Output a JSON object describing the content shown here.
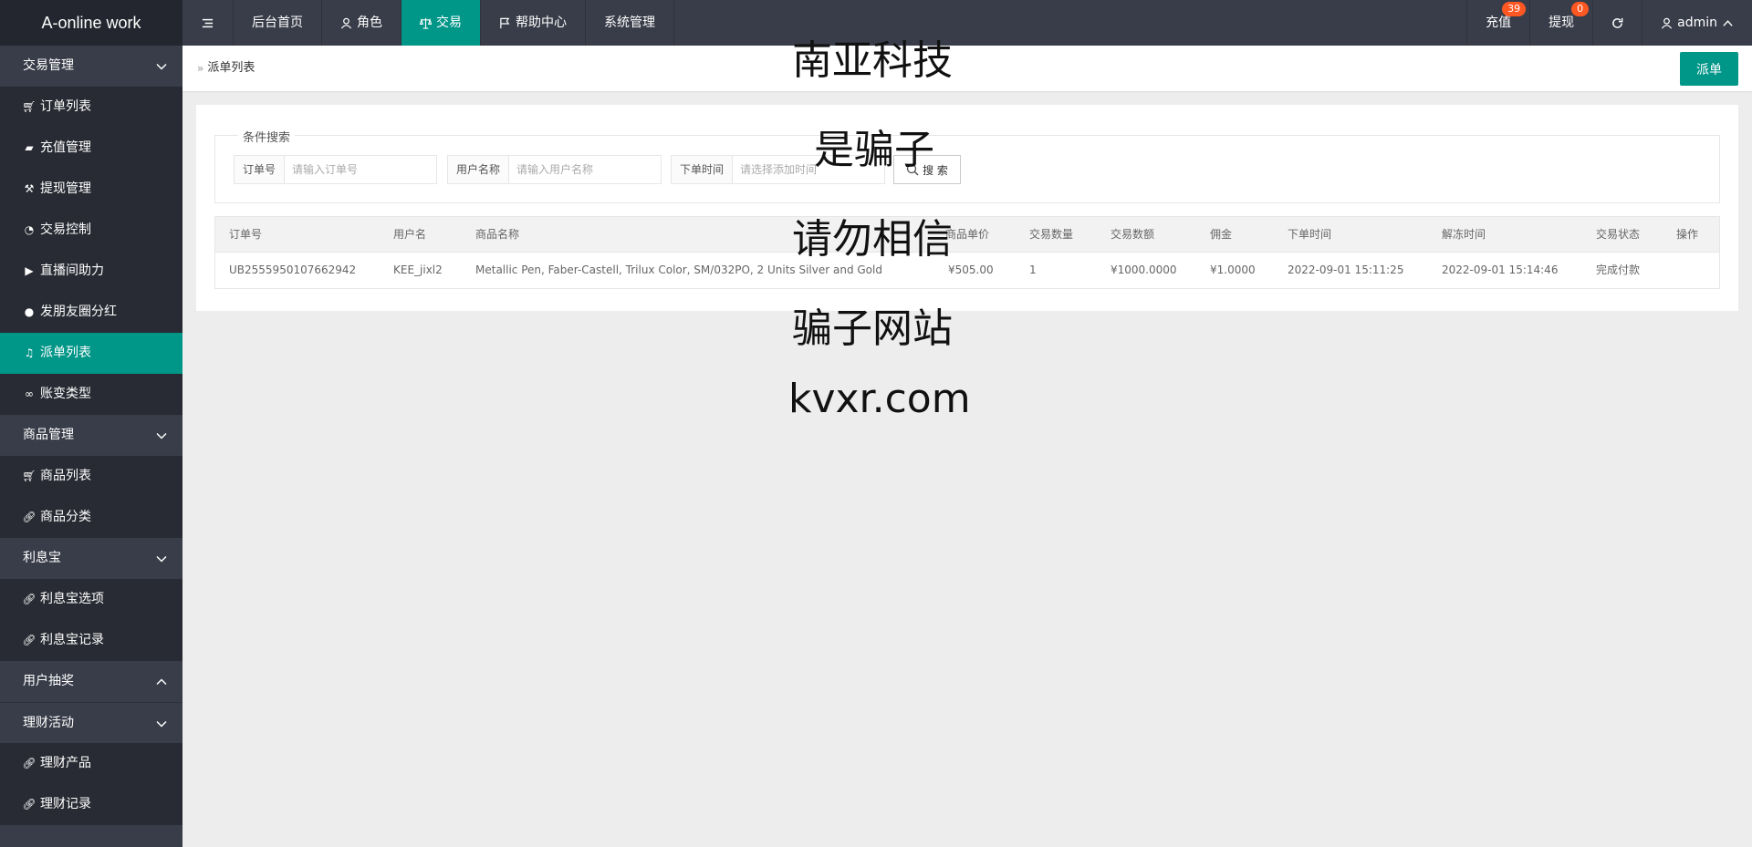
{
  "header": {
    "logo": "A-online work",
    "nav": [
      {
        "label": "后台首页"
      },
      {
        "label": "角色"
      },
      {
        "label": "交易"
      },
      {
        "label": "帮助中心"
      },
      {
        "label": "系统管理"
      }
    ],
    "right": {
      "recharge_label": "充值",
      "recharge_badge": "39",
      "withdraw_label": "提现",
      "withdraw_badge": "0",
      "user_label": "admin"
    }
  },
  "sidebar": {
    "groups": [
      {
        "label": "交易管理",
        "items": [
          "订单列表",
          "充值管理",
          "提现管理",
          "交易控制",
          "直播间助力",
          "发朋友圈分红",
          "派单列表",
          "账变类型"
        ]
      },
      {
        "label": "商品管理",
        "items": [
          "商品列表",
          "商品分类"
        ]
      },
      {
        "label": "利息宝",
        "items": [
          "利息宝选项",
          "利息宝记录"
        ]
      },
      {
        "label": "用户抽奖",
        "items": []
      },
      {
        "label": "理财活动",
        "items": [
          "理财产品",
          "理财记录"
        ]
      }
    ]
  },
  "breadcrumb": "派单列表",
  "dispatch_button": "派单",
  "search": {
    "legend": "条件搜索",
    "order_no_label": "订单号",
    "order_no_placeholder": "请输入订单号",
    "username_label": "用户名称",
    "username_placeholder": "请输入用户名称",
    "time_label": "下单时间",
    "time_placeholder": "请选择添加时间",
    "button": "搜 索"
  },
  "table": {
    "headers": [
      "订单号",
      "用户名",
      "商品名称",
      "商品单价",
      "交易数量",
      "交易数额",
      "佣金",
      "下单时间",
      "解冻时间",
      "交易状态",
      "操作"
    ],
    "rows": [
      [
        "UB2555950107662942",
        "KEE_jixl2",
        "Metallic Pen, Faber-Castell, Trilux Color, SM/032PO, 2 Units Silver and Gold",
        "¥505.00",
        "1",
        "¥1000.0000",
        "¥1.0000",
        "2022-09-01 15:11:25",
        "2022-09-01 15:14:46",
        "完成付款",
        ""
      ]
    ]
  },
  "watermark": [
    "南亚科技",
    "是骗子",
    "请勿相信",
    "骗子网站",
    "kvxr.com"
  ],
  "colors": {
    "accent": "#009688",
    "header_bg": "#393d49",
    "badge": "#ff5722"
  }
}
